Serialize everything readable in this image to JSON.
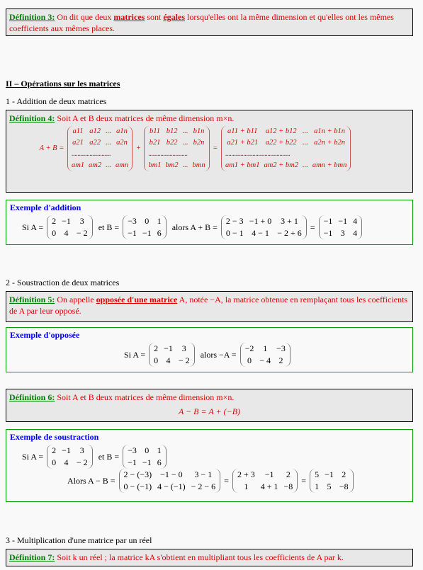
{
  "def3": {
    "label": "Définition 3:",
    "pre": " On dit que deux ",
    "bold": "matrices",
    "mid": " sont ",
    "bold2": "égales",
    "post": " lorsqu'elles ont la même dimension et qu'elles ont les mêmes coefficients aux mêmes places."
  },
  "section2": "II – Opérations sur les matrices",
  "sub1": "1 - Addition de deux matrices",
  "def4": {
    "label": "Définition 4:",
    "text": " Soit A et B deux matrices de même dimension m×n.",
    "expr": [
      {
        "t": "A + B ="
      },
      {
        "m": [
          [
            "a11",
            "a12",
            "...",
            "a1n"
          ],
          [
            "a21",
            "a22",
            "...",
            "a2n"
          ],
          [
            "..........................",
            "",
            "",
            ""
          ],
          [
            "am1",
            "am2",
            "...",
            "amn"
          ]
        ]
      },
      {
        "t": "+"
      },
      {
        "m": [
          [
            "b11",
            "b12",
            "...",
            "b1n"
          ],
          [
            "b21",
            "b22",
            "...",
            "b2n"
          ],
          [
            "..........................",
            "",
            "",
            ""
          ],
          [
            "bm1",
            "bm2",
            "...",
            "bmn"
          ]
        ]
      },
      {
        "t": "="
      },
      {
        "m": [
          [
            "a11 + b11",
            "a12 + b12",
            "...",
            "a1n + b1n"
          ],
          [
            "a21 + b21",
            "a22 + b22",
            "...",
            "a2n + b2n"
          ],
          [
            "...........................................",
            "",
            "",
            ""
          ],
          [
            "am1 + bm1",
            "am2 + bm2",
            "...",
            "amn + bmn"
          ]
        ]
      }
    ]
  },
  "ex_add": {
    "title": "Exemple d'addition",
    "expr": [
      {
        "t": "Si  A ="
      },
      {
        "m": [
          [
            "2",
            "−1",
            "3"
          ],
          [
            "0",
            "4",
            "− 2"
          ]
        ]
      },
      {
        "t": " et  B ="
      },
      {
        "m": [
          [
            "−3",
            "0",
            "1"
          ],
          [
            "−1",
            "−1",
            "6"
          ]
        ]
      },
      {
        "t": " alors A + B ="
      },
      {
        "m": [
          [
            "2 − 3",
            "−1 + 0",
            "3 + 1"
          ],
          [
            "0 − 1",
            "4 − 1",
            "− 2 + 6"
          ]
        ]
      },
      {
        "t": "="
      },
      {
        "m": [
          [
            "−1",
            "−1",
            "4"
          ],
          [
            "−1",
            "3",
            "4"
          ]
        ]
      }
    ]
  },
  "sub2": "2 - Soustraction de deux matrices",
  "def5": {
    "label": "Définition 5:",
    "pre": " On appelle ",
    "bold": "opposée d'une matrice",
    "post": " A, notée −A, la matrice obtenue en remplaçant tous les coefficients de A par leur opposé."
  },
  "ex_opp": {
    "title": "Exemple d'opposée",
    "expr": [
      {
        "t": "Si  A ="
      },
      {
        "m": [
          [
            "2",
            "−1",
            "3"
          ],
          [
            "0",
            "4",
            "− 2"
          ]
        ]
      },
      {
        "t": " alors −A ="
      },
      {
        "m": [
          [
            "−2",
            "1",
            "−3"
          ],
          [
            "0",
            "− 4",
            "2"
          ]
        ]
      }
    ]
  },
  "def6": {
    "label": "Définition 6:",
    "text": " Soit A et B deux matrices de même dimension m×n.",
    "formula": "A − B = A + (−B)"
  },
  "ex_sub": {
    "title": "Exemple de soustraction",
    "expr1": [
      {
        "t": "Si  A ="
      },
      {
        "m": [
          [
            "2",
            "−1",
            "3"
          ],
          [
            "0",
            "4",
            "− 2"
          ]
        ]
      },
      {
        "t": " et  B ="
      },
      {
        "m": [
          [
            "−3",
            "0",
            "1"
          ],
          [
            "−1",
            "−1",
            "6"
          ]
        ]
      }
    ],
    "expr2": [
      {
        "t": "Alors  A − B ="
      },
      {
        "m": [
          [
            "2 − (−3)",
            "−1 − 0",
            "3 − 1"
          ],
          [
            "0 − (−1)",
            "4 − (−1)",
            "− 2 − 6"
          ]
        ]
      },
      {
        "t": "="
      },
      {
        "m": [
          [
            "2 + 3",
            "−1",
            "2"
          ],
          [
            "1",
            "4 + 1",
            "−8"
          ]
        ]
      },
      {
        "t": "="
      },
      {
        "m": [
          [
            "5",
            "−1",
            "2"
          ],
          [
            "1",
            "5",
            "−8"
          ]
        ]
      }
    ]
  },
  "sub3": "3 - Multiplication d'une matrice par un réel",
  "def7": {
    "label": "Définition 7:",
    "text": " Soit k un réel ; la matrice kA s'obtient en multipliant tous les coefficients de A par k."
  }
}
